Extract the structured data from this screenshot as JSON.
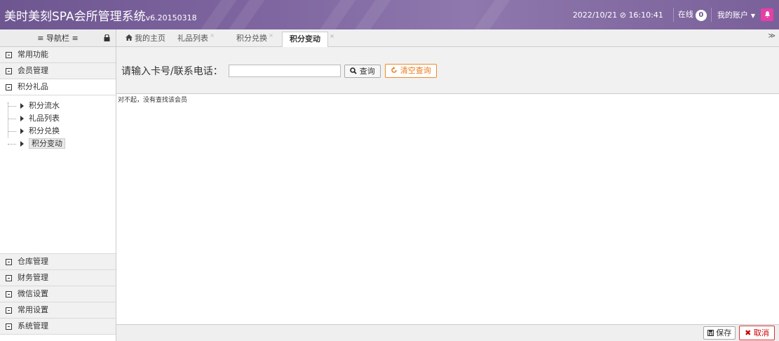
{
  "header": {
    "title": "美时美刻SPA会所管理系统",
    "version": "v6.20150318",
    "datetime_date": "2022/10/21",
    "datetime_time": "16:10:41",
    "online_label": "在线",
    "online_count": "0",
    "account_label": "我的账户"
  },
  "sidebar": {
    "nav_title": "≡ 导航栏 ≡",
    "sections": {
      "common": "常用功能",
      "members": "会员管理",
      "points": "积分礼品",
      "warehouse": "仓库管理",
      "finance": "财务管理",
      "wechat": "微信设置",
      "settings": "常用设置",
      "system": "系统管理"
    },
    "points_items": [
      "积分流水",
      "礼品列表",
      "积分兑换",
      "积分变动"
    ]
  },
  "tabs": {
    "home": "我的主页",
    "gifts": "礼品列表",
    "exchange": "积分兑换",
    "change": "积分变动",
    "close": "×",
    "more": "≫"
  },
  "search": {
    "label": "请输入卡号/联系电话：",
    "value": "",
    "query_button": "查询",
    "clear_button": "清空查询"
  },
  "content": {
    "message": "对不起，没有查找该会员"
  },
  "footer": {
    "save_button": "保存",
    "cancel_button": "取消"
  },
  "colors": {
    "header_bg": "#7f66a0",
    "clear_btn": "#f08a2b",
    "cancel_btn": "#dd3333",
    "bell_bg": "#e63fa8"
  }
}
